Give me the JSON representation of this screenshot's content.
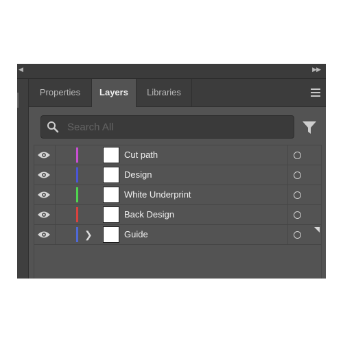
{
  "tabs": [
    {
      "label": "Properties",
      "active": false
    },
    {
      "label": "Layers",
      "active": true
    },
    {
      "label": "Libraries",
      "active": false
    }
  ],
  "search": {
    "placeholder": "Search All"
  },
  "layers": [
    {
      "name": "Cut path",
      "color": "#c94fd3",
      "expandable": false
    },
    {
      "name": "Design",
      "color": "#4a55d6",
      "expandable": false
    },
    {
      "name": "White Underprint",
      "color": "#4fd44f",
      "expandable": false
    },
    {
      "name": "Back Design",
      "color": "#d9423e",
      "expandable": false
    },
    {
      "name": "Guide",
      "color": "#4f69d6",
      "expandable": true
    }
  ],
  "icons": [
    "collapse-left-icon",
    "expand-right-icon",
    "panel-menu-icon",
    "search-icon",
    "filter-icon",
    "eye-icon",
    "chevron-right-icon",
    "target-circle-icon"
  ]
}
